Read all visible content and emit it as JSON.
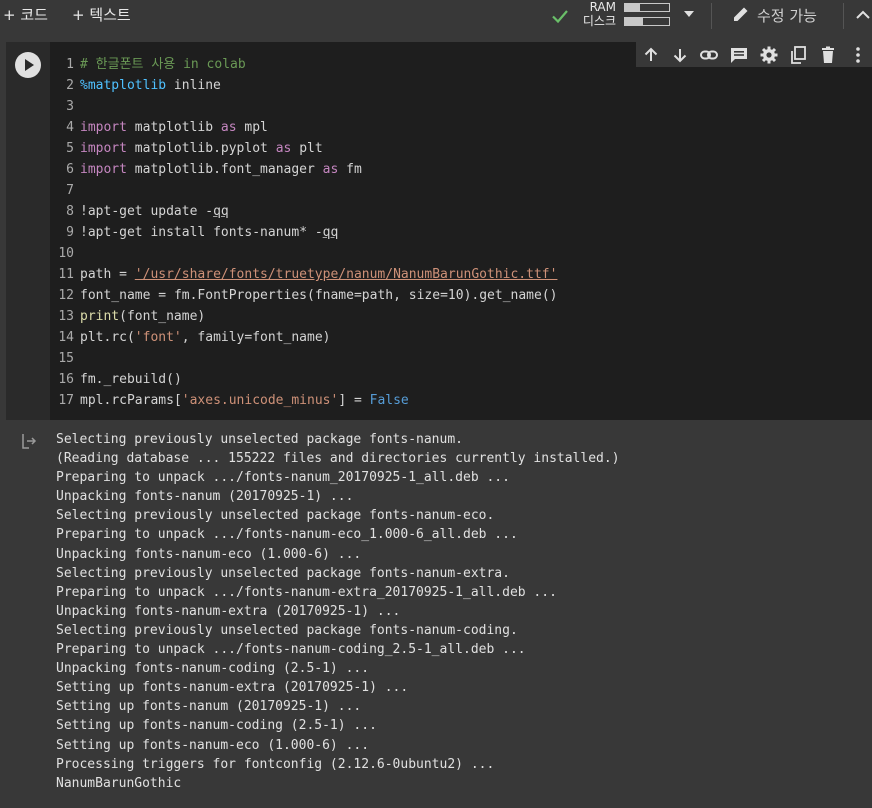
{
  "toolbar": {
    "add_code": "+ 코드",
    "add_text": "+ 텍스트",
    "ram_label": "RAM",
    "disk_label": "디스크",
    "ram_usage": 0.35,
    "disk_usage": 0.4,
    "edit_label": "수정 가능"
  },
  "cell_actions": [
    "arrow-up-icon",
    "arrow-down-icon",
    "link-icon",
    "comment-icon",
    "gear-icon",
    "mirror-cell-icon",
    "trash-icon",
    "more-vert-icon"
  ],
  "code_lines": [
    "# 한글폰트 사용 in colab",
    "%matplotlib inline",
    "",
    "import matplotlib as mpl",
    "import matplotlib.pyplot as plt",
    "import matplotlib.font_manager as fm",
    "",
    "!apt-get update -qq",
    "!apt-get install fonts-nanum* -qq",
    "",
    "path = '/usr/share/fonts/truetype/nanum/NanumBarunGothic.ttf'",
    "font_name = fm.FontProperties(fname=path, size=10).get_name()",
    "print(font_name)",
    "plt.rc('font', family=font_name)",
    "",
    "fm._rebuild()",
    "mpl.rcParams['axes.unicode_minus'] = False"
  ],
  "output_lines": [
    "Selecting previously unselected package fonts-nanum.",
    "(Reading database ... 155222 files and directories currently installed.)",
    "Preparing to unpack .../fonts-nanum_20170925-1_all.deb ...",
    "Unpacking fonts-nanum (20170925-1) ...",
    "Selecting previously unselected package fonts-nanum-eco.",
    "Preparing to unpack .../fonts-nanum-eco_1.000-6_all.deb ...",
    "Unpacking fonts-nanum-eco (1.000-6) ...",
    "Selecting previously unselected package fonts-nanum-extra.",
    "Preparing to unpack .../fonts-nanum-extra_20170925-1_all.deb ...",
    "Unpacking fonts-nanum-extra (20170925-1) ...",
    "Selecting previously unselected package fonts-nanum-coding.",
    "Preparing to unpack .../fonts-nanum-coding_2.5-1_all.deb ...",
    "Unpacking fonts-nanum-coding (2.5-1) ...",
    "Setting up fonts-nanum-extra (20170925-1) ...",
    "Setting up fonts-nanum (20170925-1) ...",
    "Setting up fonts-nanum-coding (2.5-1) ...",
    "Setting up fonts-nanum-eco (1.000-6) ...",
    "Processing triggers for fontconfig (2.12.6-0ubuntu2) ...",
    "NanumBarunGothic"
  ]
}
